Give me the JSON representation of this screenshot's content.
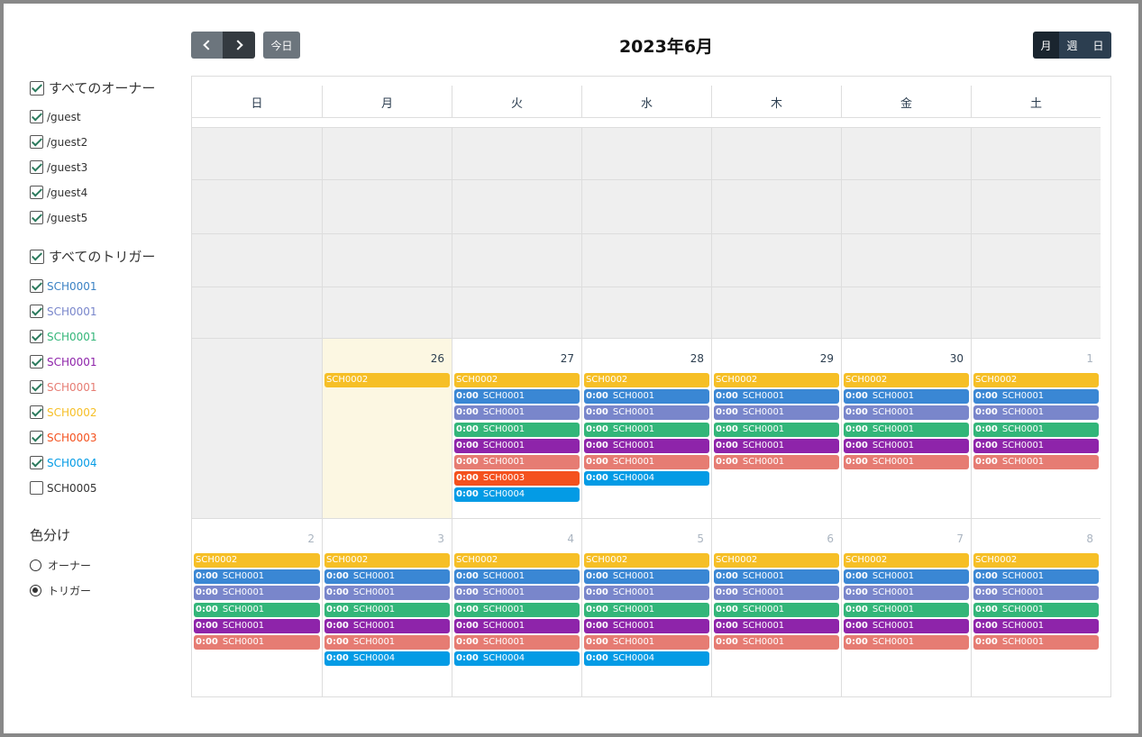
{
  "sidebar": {
    "all_owners": "すべてのオーナー",
    "owners": [
      "/guest",
      "/guest2",
      "/guest3",
      "/guest4",
      "/guest5"
    ],
    "all_triggers": "すべてのトリガー",
    "triggers": [
      {
        "label": "SCH0001",
        "color": "#3b82c4",
        "checked": true
      },
      {
        "label": "SCH0001",
        "color": "#7986cb",
        "checked": true
      },
      {
        "label": "SCH0001",
        "color": "#33b679",
        "checked": true
      },
      {
        "label": "SCH0001",
        "color": "#8e24aa",
        "checked": true
      },
      {
        "label": "SCH0001",
        "color": "#e67c73",
        "checked": true
      },
      {
        "label": "SCH0002",
        "color": "#f6bf26",
        "checked": true
      },
      {
        "label": "SCH0003",
        "color": "#f4511e",
        "checked": true
      },
      {
        "label": "SCH0004",
        "color": "#039be5",
        "checked": true
      },
      {
        "label": "SCH0005",
        "color": "#333333",
        "checked": false
      }
    ],
    "color_by_title": "色分け",
    "color_by_options": [
      {
        "label": "オーナー",
        "selected": false
      },
      {
        "label": "トリガー",
        "selected": true
      }
    ]
  },
  "toolbar": {
    "today_label": "今日",
    "title": "2023年6月",
    "views": [
      {
        "label": "月",
        "active": true
      },
      {
        "label": "週",
        "active": false
      },
      {
        "label": "日",
        "active": false
      }
    ]
  },
  "calendar": {
    "weekdays": [
      "日",
      "月",
      "火",
      "水",
      "木",
      "金",
      "土"
    ],
    "colors": {
      "sch0001a": "#3a87d4",
      "sch0001b": "#7986cb",
      "sch0001c": "#33b679",
      "sch0001d": "#8e24aa",
      "sch0001e": "#e67c73",
      "sch0002": "#f6bf26",
      "sch0003": "#f4511e",
      "sch0004": "#039be5"
    },
    "weeks": [
      {
        "days": [
          {
            "num": "",
            "state": "out",
            "events": []
          },
          {
            "num": "",
            "state": "out",
            "events": []
          },
          {
            "num": "",
            "state": "out",
            "events": []
          },
          {
            "num": "",
            "state": "out",
            "events": []
          },
          {
            "num": "",
            "state": "out",
            "events": []
          },
          {
            "num": "",
            "state": "out",
            "events": []
          },
          {
            "num": "",
            "state": "out",
            "events": []
          }
        ]
      },
      {
        "days": [
          {
            "num": "",
            "state": "out",
            "events": []
          },
          {
            "num": "26",
            "state": "today",
            "events": [
              {
                "time": "",
                "title": "SCH0002",
                "color": "sch0002"
              }
            ]
          },
          {
            "num": "27",
            "state": "normal",
            "events": [
              {
                "time": "",
                "title": "SCH0002",
                "color": "sch0002"
              },
              {
                "time": "0:00",
                "title": "SCH0001",
                "color": "sch0001a"
              },
              {
                "time": "0:00",
                "title": "SCH0001",
                "color": "sch0001b"
              },
              {
                "time": "0:00",
                "title": "SCH0001",
                "color": "sch0001c"
              },
              {
                "time": "0:00",
                "title": "SCH0001",
                "color": "sch0001d"
              },
              {
                "time": "0:00",
                "title": "SCH0001",
                "color": "sch0001e"
              },
              {
                "time": "0:00",
                "title": "SCH0003",
                "color": "sch0003"
              },
              {
                "time": "0:00",
                "title": "SCH0004",
                "color": "sch0004"
              }
            ]
          },
          {
            "num": "28",
            "state": "normal",
            "events": [
              {
                "time": "",
                "title": "SCH0002",
                "color": "sch0002"
              },
              {
                "time": "0:00",
                "title": "SCH0001",
                "color": "sch0001a"
              },
              {
                "time": "0:00",
                "title": "SCH0001",
                "color": "sch0001b"
              },
              {
                "time": "0:00",
                "title": "SCH0001",
                "color": "sch0001c"
              },
              {
                "time": "0:00",
                "title": "SCH0001",
                "color": "sch0001d"
              },
              {
                "time": "0:00",
                "title": "SCH0001",
                "color": "sch0001e"
              },
              {
                "time": "0:00",
                "title": "SCH0004",
                "color": "sch0004"
              }
            ]
          },
          {
            "num": "29",
            "state": "normal",
            "events": [
              {
                "time": "",
                "title": "SCH0002",
                "color": "sch0002"
              },
              {
                "time": "0:00",
                "title": "SCH0001",
                "color": "sch0001a"
              },
              {
                "time": "0:00",
                "title": "SCH0001",
                "color": "sch0001b"
              },
              {
                "time": "0:00",
                "title": "SCH0001",
                "color": "sch0001c"
              },
              {
                "time": "0:00",
                "title": "SCH0001",
                "color": "sch0001d"
              },
              {
                "time": "0:00",
                "title": "SCH0001",
                "color": "sch0001e"
              }
            ]
          },
          {
            "num": "30",
            "state": "normal",
            "events": [
              {
                "time": "",
                "title": "SCH0002",
                "color": "sch0002"
              },
              {
                "time": "0:00",
                "title": "SCH0001",
                "color": "sch0001a"
              },
              {
                "time": "0:00",
                "title": "SCH0001",
                "color": "sch0001b"
              },
              {
                "time": "0:00",
                "title": "SCH0001",
                "color": "sch0001c"
              },
              {
                "time": "0:00",
                "title": "SCH0001",
                "color": "sch0001d"
              },
              {
                "time": "0:00",
                "title": "SCH0001",
                "color": "sch0001e"
              }
            ]
          },
          {
            "num": "1",
            "state": "other",
            "events": [
              {
                "time": "",
                "title": "SCH0002",
                "color": "sch0002"
              },
              {
                "time": "0:00",
                "title": "SCH0001",
                "color": "sch0001a"
              },
              {
                "time": "0:00",
                "title": "SCH0001",
                "color": "sch0001b"
              },
              {
                "time": "0:00",
                "title": "SCH0001",
                "color": "sch0001c"
              },
              {
                "time": "0:00",
                "title": "SCH0001",
                "color": "sch0001d"
              },
              {
                "time": "0:00",
                "title": "SCH0001",
                "color": "sch0001e"
              }
            ]
          }
        ]
      },
      {
        "days": [
          {
            "num": "2",
            "state": "other",
            "events": [
              {
                "time": "",
                "title": "SCH0002",
                "color": "sch0002"
              },
              {
                "time": "0:00",
                "title": "SCH0001",
                "color": "sch0001a"
              },
              {
                "time": "0:00",
                "title": "SCH0001",
                "color": "sch0001b"
              },
              {
                "time": "0:00",
                "title": "SCH0001",
                "color": "sch0001c"
              },
              {
                "time": "0:00",
                "title": "SCH0001",
                "color": "sch0001d"
              },
              {
                "time": "0:00",
                "title": "SCH0001",
                "color": "sch0001e"
              }
            ]
          },
          {
            "num": "3",
            "state": "other",
            "events": [
              {
                "time": "",
                "title": "SCH0002",
                "color": "sch0002"
              },
              {
                "time": "0:00",
                "title": "SCH0001",
                "color": "sch0001a"
              },
              {
                "time": "0:00",
                "title": "SCH0001",
                "color": "sch0001b"
              },
              {
                "time": "0:00",
                "title": "SCH0001",
                "color": "sch0001c"
              },
              {
                "time": "0:00",
                "title": "SCH0001",
                "color": "sch0001d"
              },
              {
                "time": "0:00",
                "title": "SCH0001",
                "color": "sch0001e"
              },
              {
                "time": "0:00",
                "title": "SCH0004",
                "color": "sch0004"
              }
            ]
          },
          {
            "num": "4",
            "state": "other",
            "events": [
              {
                "time": "",
                "title": "SCH0002",
                "color": "sch0002"
              },
              {
                "time": "0:00",
                "title": "SCH0001",
                "color": "sch0001a"
              },
              {
                "time": "0:00",
                "title": "SCH0001",
                "color": "sch0001b"
              },
              {
                "time": "0:00",
                "title": "SCH0001",
                "color": "sch0001c"
              },
              {
                "time": "0:00",
                "title": "SCH0001",
                "color": "sch0001d"
              },
              {
                "time": "0:00",
                "title": "SCH0001",
                "color": "sch0001e"
              },
              {
                "time": "0:00",
                "title": "SCH0004",
                "color": "sch0004"
              }
            ]
          },
          {
            "num": "5",
            "state": "other",
            "events": [
              {
                "time": "",
                "title": "SCH0002",
                "color": "sch0002"
              },
              {
                "time": "0:00",
                "title": "SCH0001",
                "color": "sch0001a"
              },
              {
                "time": "0:00",
                "title": "SCH0001",
                "color": "sch0001b"
              },
              {
                "time": "0:00",
                "title": "SCH0001",
                "color": "sch0001c"
              },
              {
                "time": "0:00",
                "title": "SCH0001",
                "color": "sch0001d"
              },
              {
                "time": "0:00",
                "title": "SCH0001",
                "color": "sch0001e"
              },
              {
                "time": "0:00",
                "title": "SCH0004",
                "color": "sch0004"
              }
            ]
          },
          {
            "num": "6",
            "state": "other",
            "events": [
              {
                "time": "",
                "title": "SCH0002",
                "color": "sch0002"
              },
              {
                "time": "0:00",
                "title": "SCH0001",
                "color": "sch0001a"
              },
              {
                "time": "0:00",
                "title": "SCH0001",
                "color": "sch0001b"
              },
              {
                "time": "0:00",
                "title": "SCH0001",
                "color": "sch0001c"
              },
              {
                "time": "0:00",
                "title": "SCH0001",
                "color": "sch0001d"
              },
              {
                "time": "0:00",
                "title": "SCH0001",
                "color": "sch0001e"
              }
            ]
          },
          {
            "num": "7",
            "state": "other",
            "events": [
              {
                "time": "",
                "title": "SCH0002",
                "color": "sch0002"
              },
              {
                "time": "0:00",
                "title": "SCH0001",
                "color": "sch0001a"
              },
              {
                "time": "0:00",
                "title": "SCH0001",
                "color": "sch0001b"
              },
              {
                "time": "0:00",
                "title": "SCH0001",
                "color": "sch0001c"
              },
              {
                "time": "0:00",
                "title": "SCH0001",
                "color": "sch0001d"
              },
              {
                "time": "0:00",
                "title": "SCH0001",
                "color": "sch0001e"
              }
            ]
          },
          {
            "num": "8",
            "state": "other",
            "events": [
              {
                "time": "",
                "title": "SCH0002",
                "color": "sch0002"
              },
              {
                "time": "0:00",
                "title": "SCH0001",
                "color": "sch0001a"
              },
              {
                "time": "0:00",
                "title": "SCH0001",
                "color": "sch0001b"
              },
              {
                "time": "0:00",
                "title": "SCH0001",
                "color": "sch0001c"
              },
              {
                "time": "0:00",
                "title": "SCH0001",
                "color": "sch0001d"
              },
              {
                "time": "0:00",
                "title": "SCH0001",
                "color": "sch0001e"
              }
            ]
          }
        ]
      }
    ]
  }
}
